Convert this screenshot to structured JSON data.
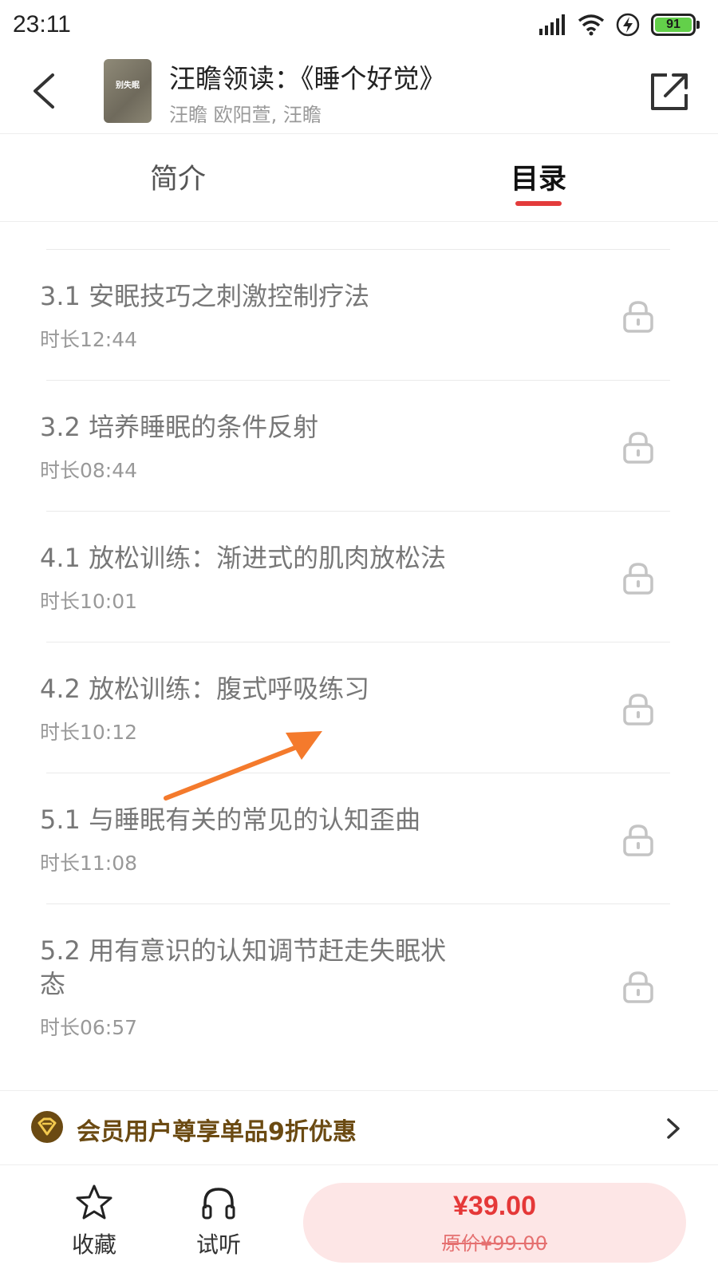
{
  "status_bar": {
    "time": "23:11",
    "battery": "91"
  },
  "header": {
    "cover_text": "别失眠",
    "title": "汪瞻领读：《睡个好觉》",
    "authors": "汪瞻 欧阳萱, 汪瞻"
  },
  "tabs": [
    {
      "label": "简介",
      "active": false
    },
    {
      "label": "目录",
      "active": true
    }
  ],
  "chapters": [
    {
      "title": "3.1 安眠技巧之刺激控制疗法",
      "duration": "时长12:44",
      "locked": true
    },
    {
      "title": "3.2 培养睡眠的条件反射",
      "duration": "时长08:44",
      "locked": true
    },
    {
      "title": "4.1 放松训练：渐进式的肌肉放松法",
      "duration": "时长10:01",
      "locked": true
    },
    {
      "title": "4.2 放松训练：腹式呼吸练习",
      "duration": "时长10:12",
      "locked": true
    },
    {
      "title": "5.1 与睡眠有关的常见的认知歪曲",
      "duration": "时长11:08",
      "locked": true
    },
    {
      "title_line1": "5.2 用有意识的认知调节赶走失眠状",
      "title_line2": "态",
      "duration": "时长06:57",
      "locked": true
    }
  ],
  "promo": {
    "text": "会员用户尊享单品9折优惠"
  },
  "bottom_bar": {
    "favorite_label": "收藏",
    "listen_label": "试听",
    "price": "¥39.00",
    "original_price": "原价¥99.00"
  },
  "colors": {
    "accent": "#e33b3b",
    "promo_text": "#6b4a12",
    "buy_bg": "#fde6e6",
    "annotation": "#f47a2c"
  },
  "icons": [
    "back-icon",
    "share-icon",
    "lock-icon",
    "vip-icon",
    "chevron-right-icon",
    "star-icon",
    "headphones-icon"
  ]
}
